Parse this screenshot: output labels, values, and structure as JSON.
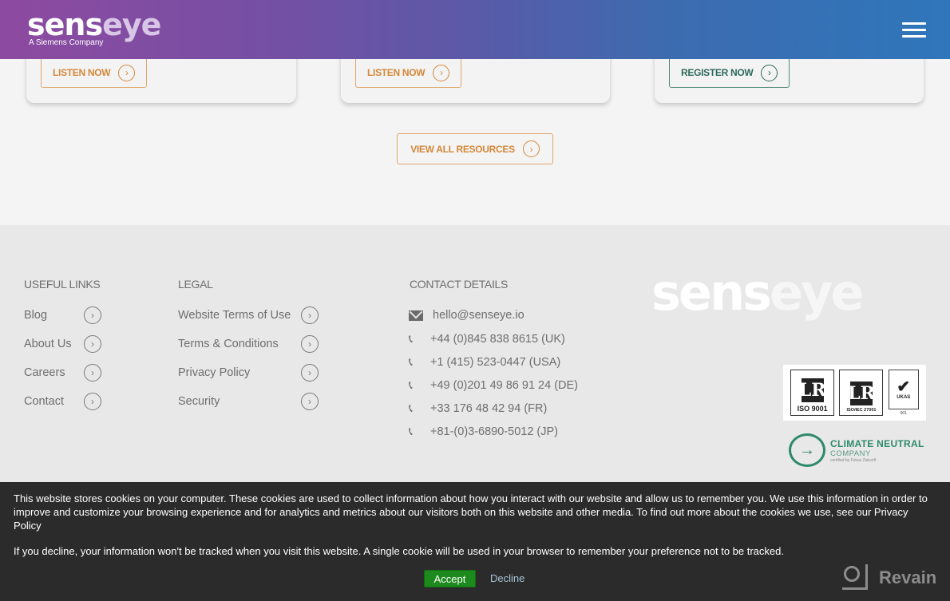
{
  "header": {
    "logo_part1": "sens",
    "logo_part2": "eye",
    "logo_tagline": "A Siemens Company",
    "menu_icon": "hamburger-menu-icon"
  },
  "cards": [
    {
      "button_label": "LISTEN NOW",
      "button_color": "#d4883a"
    },
    {
      "button_label": "LISTEN NOW",
      "button_color": "#d4883a"
    },
    {
      "button_label": "REGISTER NOW",
      "button_color": "#2e6a5a"
    }
  ],
  "view_all_label": "VIEW ALL RESOURCES",
  "footer": {
    "useful_links": {
      "title": "USEFUL LINKS",
      "items": [
        "Blog",
        "About Us",
        "Careers",
        "Contact"
      ]
    },
    "legal": {
      "title": "LEGAL",
      "items": [
        "Website Terms of Use",
        "Terms & Conditions",
        "Privacy Policy",
        "Security"
      ]
    },
    "contact": {
      "title": "CONTACT DETAILS",
      "email": "hello@senseye.io",
      "phones": [
        "+44 (0)845 838 8615 (UK)",
        "+1 (415) 523-0447 (USA)",
        "+49 (0)201 49 86 91 24 (DE)",
        "+33 176 48 42 94 (FR)",
        "+81-(0)3-6890-5012 (JP)"
      ]
    },
    "logo_part1": "sens",
    "logo_part2": "eye",
    "certifications": {
      "cert1_label": "ISO 9001",
      "cert2_label": "ISO/IEC 27001",
      "cert_letters": "LR",
      "ukas_label": "UKAS",
      "ukas_number": "001"
    },
    "climate": {
      "title": "CLIMATE NEUTRAL",
      "subtitle": "COMPANY",
      "note": "certified by Fokus Zukunft"
    }
  },
  "cookie_banner": {
    "text1": "This website stores cookies on your computer. These cookies are used to collect information about how you interact with our website and allow us to remember you. We use this information in order to improve and customize your browsing experience and for analytics and metrics about our visitors both on this website and other media. To find out more about the cookies we use, see our Privacy Policy",
    "text2": "If you decline, your information won't be tracked when you visit this website. A single cookie will be used in your browser to remember your preference not to be tracked.",
    "accept_label": "Accept",
    "decline_label": "Decline"
  },
  "watermark": "Revain"
}
